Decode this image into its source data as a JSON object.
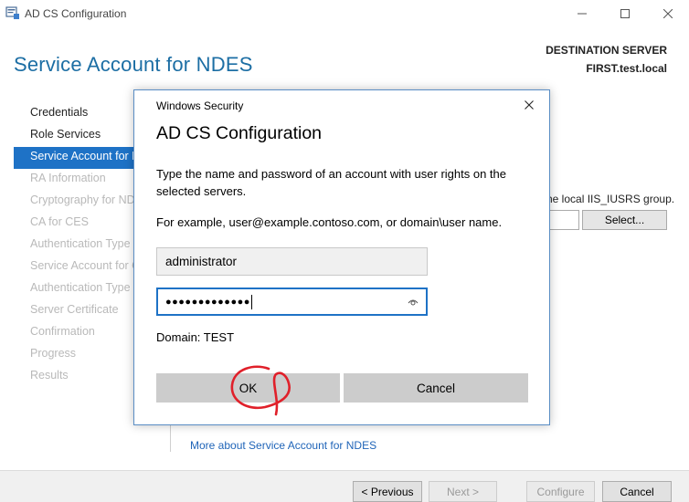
{
  "window": {
    "title": "AD CS Configuration",
    "icons": [
      "app-icon",
      "minimize-icon",
      "maximize-icon",
      "close-icon"
    ]
  },
  "header": {
    "page_title": "Service Account for NDES",
    "destination_label": "DESTINATION SERVER",
    "destination_server": "FIRST.test.local"
  },
  "sidebar": {
    "items": [
      {
        "label": "Credentials",
        "state": "enabled"
      },
      {
        "label": "Role Services",
        "state": "enabled"
      },
      {
        "label": "Service Account for NDES",
        "state": "active"
      },
      {
        "label": "RA Information",
        "state": "disabled"
      },
      {
        "label": "Cryptography for NDES",
        "state": "disabled"
      },
      {
        "label": "CA for CES",
        "state": "disabled"
      },
      {
        "label": "Authentication Type for CES",
        "state": "disabled"
      },
      {
        "label": "Service Account for CES",
        "state": "disabled"
      },
      {
        "label": "Authentication Type for CEP",
        "state": "disabled"
      },
      {
        "label": "Server Certificate",
        "state": "disabled"
      },
      {
        "label": "Confirmation",
        "state": "disabled"
      },
      {
        "label": "Progress",
        "state": "disabled"
      },
      {
        "label": "Results",
        "state": "disabled"
      }
    ]
  },
  "content": {
    "iis_text": "he local IIS_IUSRS group.",
    "select_button": "Select...",
    "more_link": "More about Service Account for NDES"
  },
  "footer": {
    "previous": "< Previous",
    "next": "Next >",
    "configure": "Configure",
    "cancel": "Cancel"
  },
  "dialog": {
    "header_label": "Windows Security",
    "title": "AD CS Configuration",
    "description": "Type the name and password of an account with user rights on the selected servers.",
    "example": "For example, user@example.contoso.com, or domain\\user name.",
    "username_value": "administrator",
    "password_mask": "●●●●●●●●●●●●●",
    "domain": "Domain: TEST",
    "ok_label": "OK",
    "cancel_label": "Cancel"
  },
  "colors": {
    "accent": "#1e72c6",
    "title_blue": "#1c6ea4",
    "annotation": "#e0202a"
  }
}
